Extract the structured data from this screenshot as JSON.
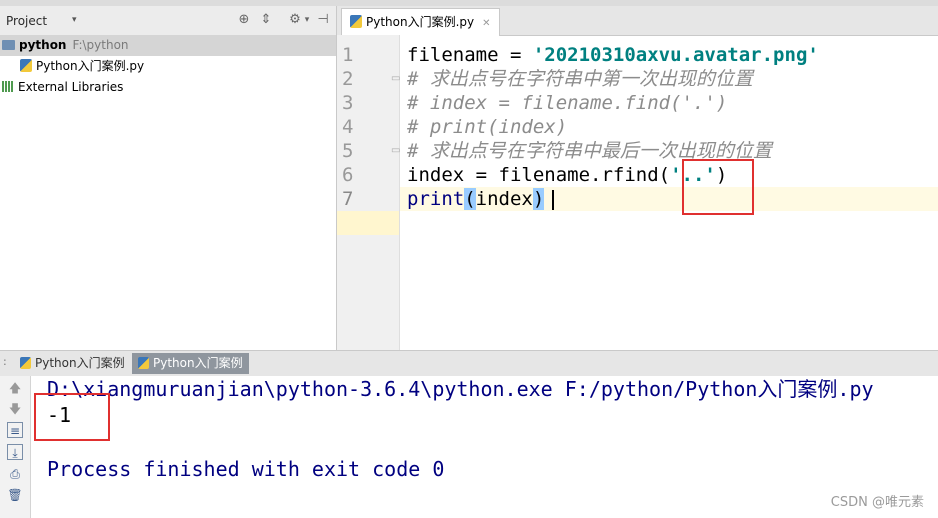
{
  "project_panel": {
    "title": "Project",
    "dropdown_glyph": "▾",
    "tree": [
      {
        "label": "python",
        "path": "F:\\python",
        "type": "folder"
      },
      {
        "label": "Python入门案例.py",
        "type": "file"
      },
      {
        "label": "External Libraries",
        "type": "libraries"
      }
    ]
  },
  "editor": {
    "tab_label": "Python入门案例.py",
    "line_numbers": [
      "1",
      "2",
      "3",
      "4",
      "5",
      "6",
      "7"
    ],
    "lines": {
      "l1_a": "filename = ",
      "l1_b": "'20210310axvu.avatar.png'",
      "l2": "# 求出点号在字符串中第一次出现的位置",
      "l3": "# index = filename.find('.')",
      "l4": "# print(index)",
      "l5": "# 求出点号在字符串中最后一次出现的位置",
      "l6_a": "index = filename.rfind(",
      "l6_b": "'..'",
      "l6_c": ")",
      "l7_a": "print",
      "l7_b": "(",
      "l7_c": "index",
      "l7_d": ")"
    }
  },
  "run_panel": {
    "tabs": [
      "Python入门案例",
      "Python入门案例"
    ],
    "active_tab": 1,
    "output": [
      "D:\\xiangmuruanjian\\python-3.6.4\\python.exe F:/python/Python入门案例.py",
      "-1",
      "",
      "Process finished with exit code 0"
    ]
  },
  "watermark": "CSDN @唯元素",
  "colors": {
    "string": "#008080",
    "comment": "#8c8c8c",
    "keyword": "#000080",
    "highlight_box": "#e0302f",
    "console_text": "#000080"
  }
}
